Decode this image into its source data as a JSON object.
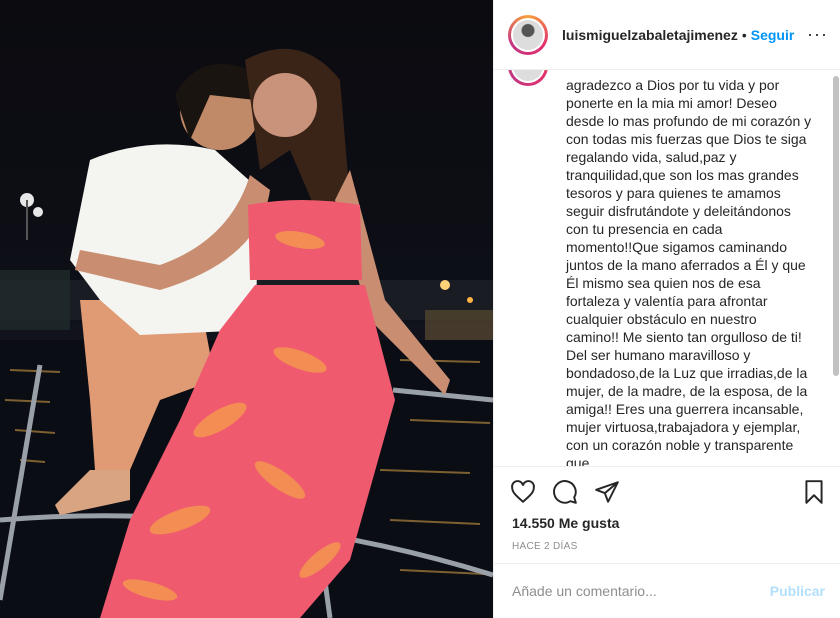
{
  "header": {
    "username": "luismiguelzabaletajimenez",
    "dot": "•",
    "follow_label": "Seguir",
    "more_label": "···"
  },
  "caption": {
    "text": "agradezco a Dios por tu vida y por ponerte en la mia mi amor! Deseo desde lo mas profundo de mi corazón y con todas mis fuerzas que Dios te siga regalando vida, salud,paz y tranquilidad,que son los mas grandes tesoros y para quienes te amamos seguir disfrutándote y deleitándonos con tu presencia en cada momento!!Que sigamos caminando juntos de la mano aferrados a Él y que Él mismo sea quien nos de esa fortaleza y valentía para afrontar cualquier obstáculo en nuestro camino!! Me siento tan orgulloso de ti! Del ser humano maravilloso y bondadoso,de la Luz que irradias,de la mujer, de la madre, de la esposa, de la amiga!! Eres una guerrera incansable, mujer virtuosa,trabajadora y ejemplar, con un corazón noble y transparente que"
  },
  "actions": {
    "icons": [
      "heart-icon",
      "comment-icon",
      "share-icon",
      "bookmark-icon"
    ],
    "likes": "14.550 Me gusta",
    "date": "HACE 2 DÍAS"
  },
  "comment": {
    "placeholder": "Añade un comentario...",
    "publish_label": "Publicar"
  },
  "colors": {
    "accent": "#0095f6",
    "publish_disabled": "#b2dffc",
    "dress": "#ef5a6f",
    "text": "#262626",
    "muted": "#8e8e8e"
  }
}
